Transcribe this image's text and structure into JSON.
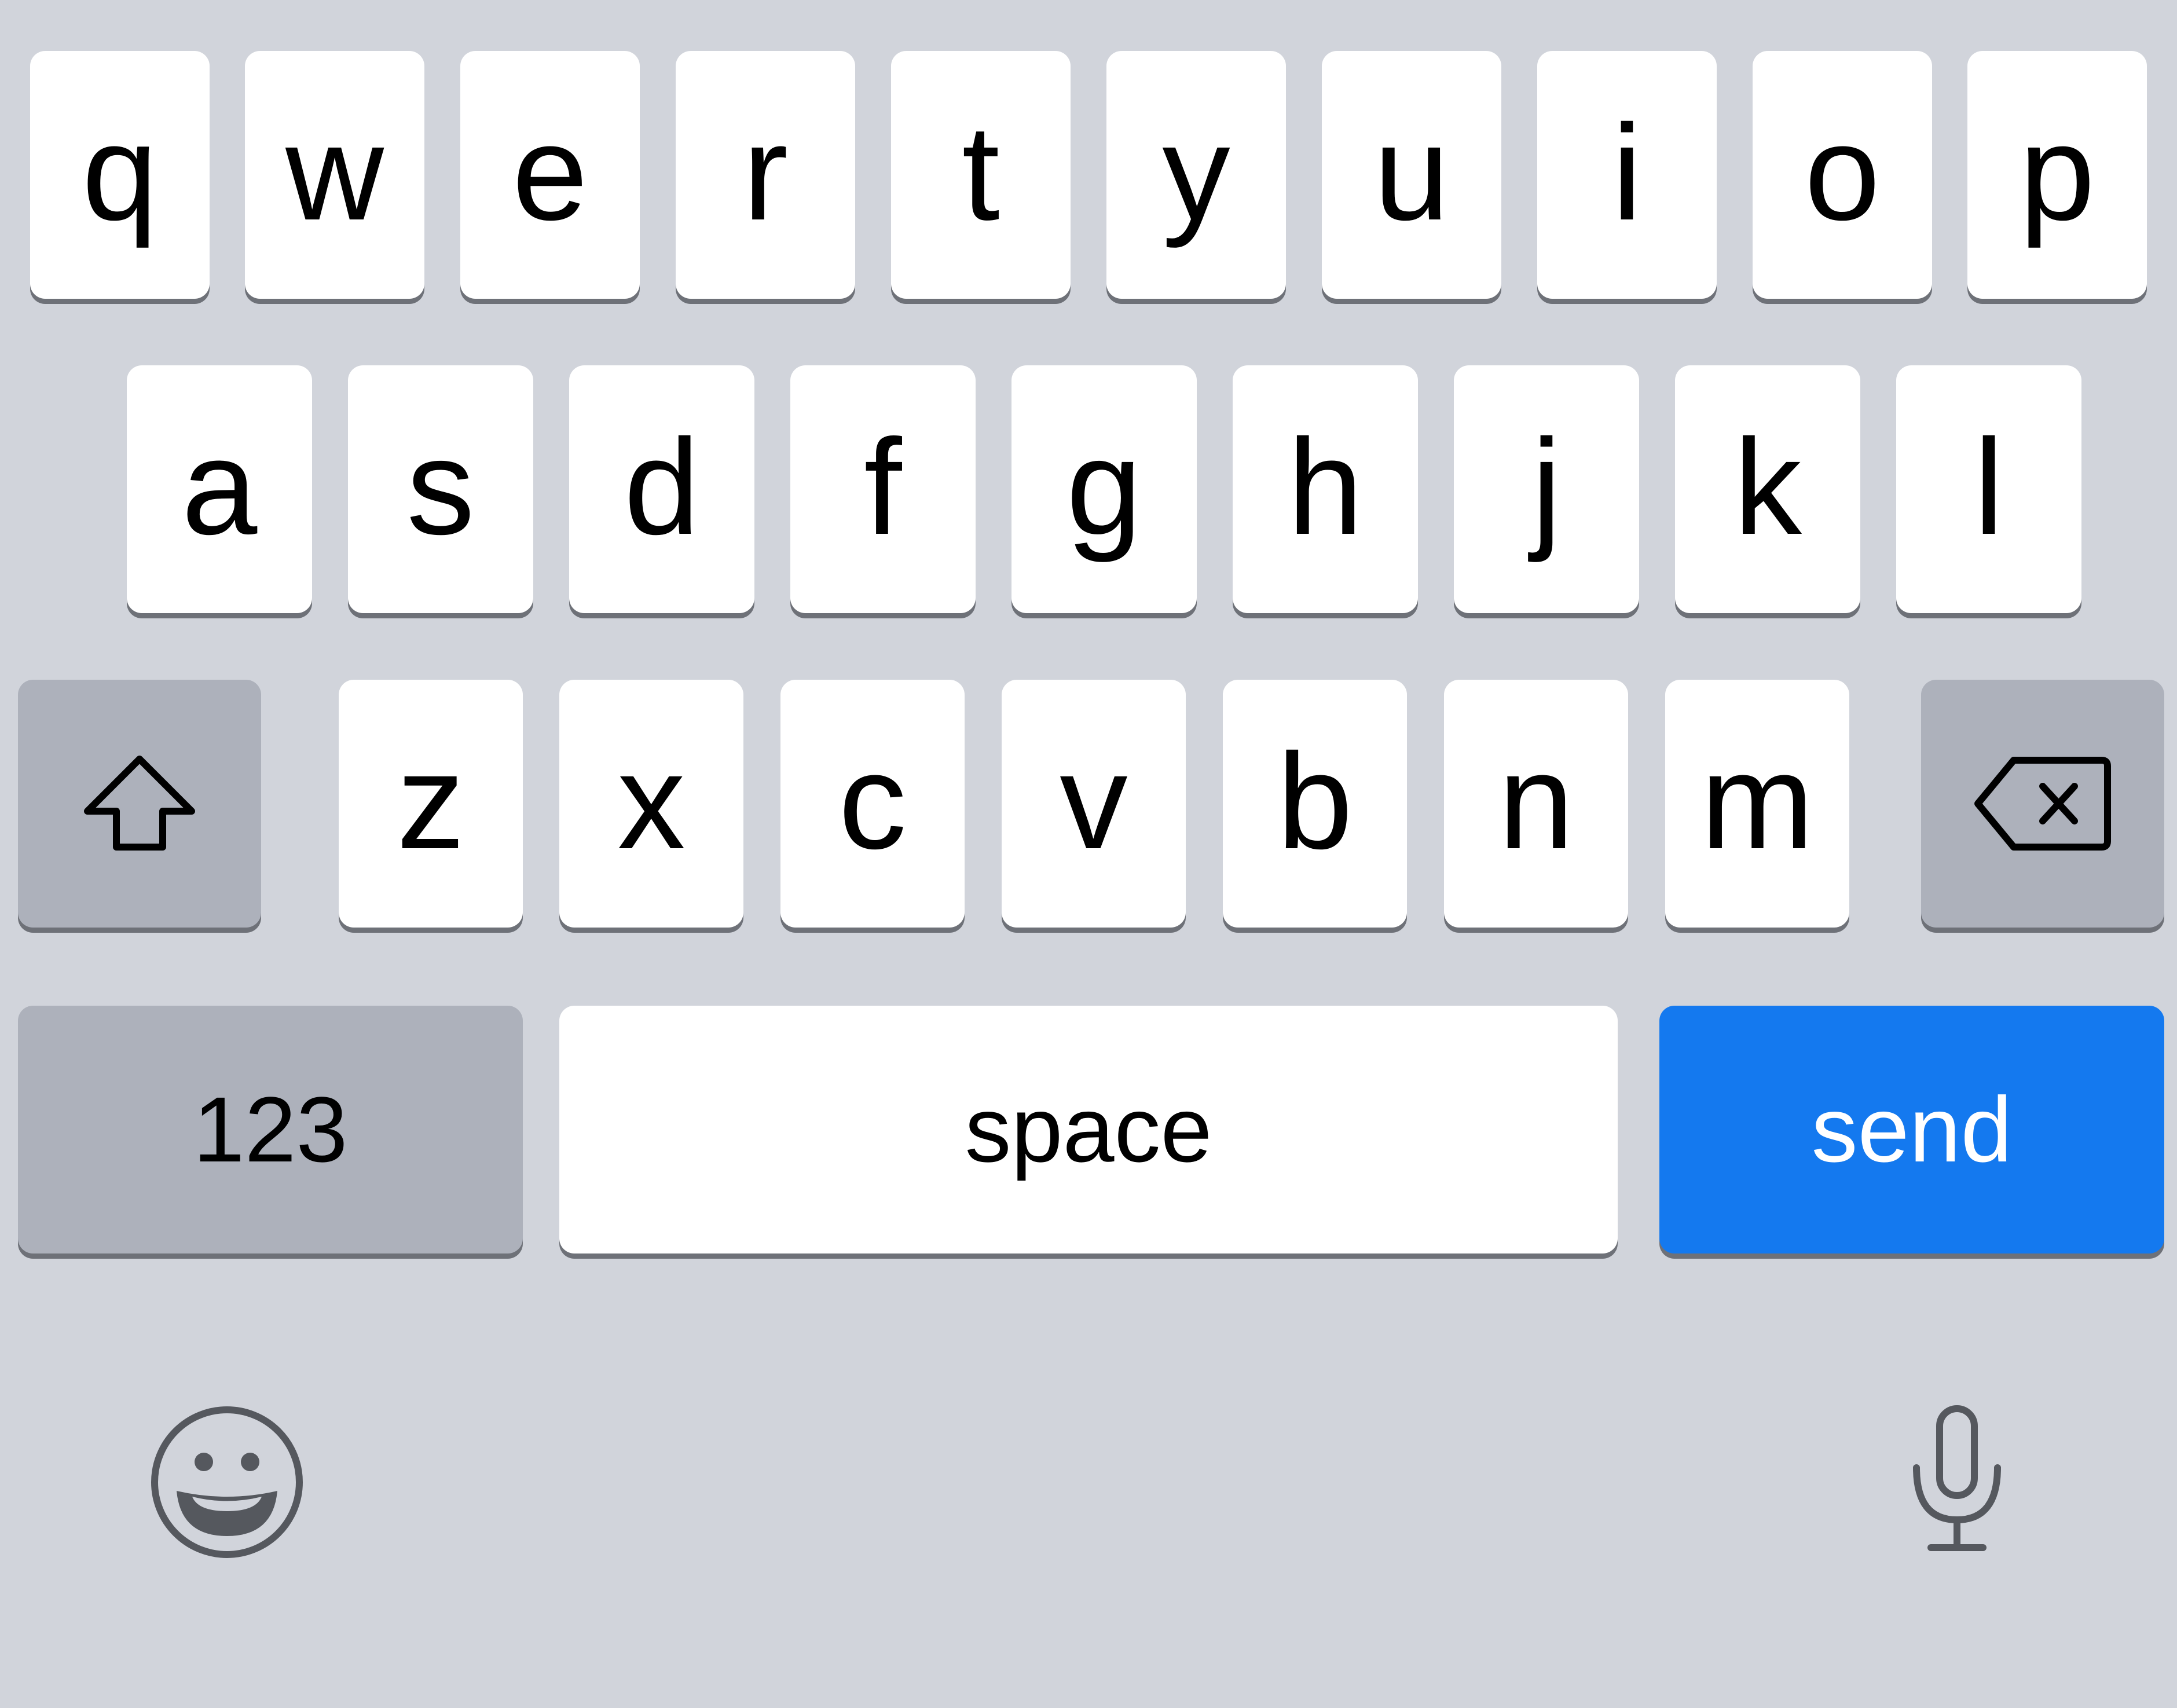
{
  "keyboard": {
    "rows": [
      [
        "q",
        "w",
        "e",
        "r",
        "t",
        "y",
        "u",
        "i",
        "o",
        "p"
      ],
      [
        "a",
        "s",
        "d",
        "f",
        "g",
        "h",
        "j",
        "k",
        "l"
      ],
      [
        "z",
        "x",
        "c",
        "v",
        "b",
        "n",
        "m"
      ]
    ],
    "numbers_label": "123",
    "space_label": "space",
    "send_label": "send",
    "colors": {
      "background": "#d1d4db",
      "key": "#ffffff",
      "function_key": "#adb1bb",
      "send": "#1479ef",
      "icon": "#55585e"
    },
    "icons": {
      "shift": "shift-arrow-up-icon",
      "delete": "backspace-icon",
      "emoji": "smiley-face-icon",
      "dictation": "microphone-icon"
    }
  }
}
